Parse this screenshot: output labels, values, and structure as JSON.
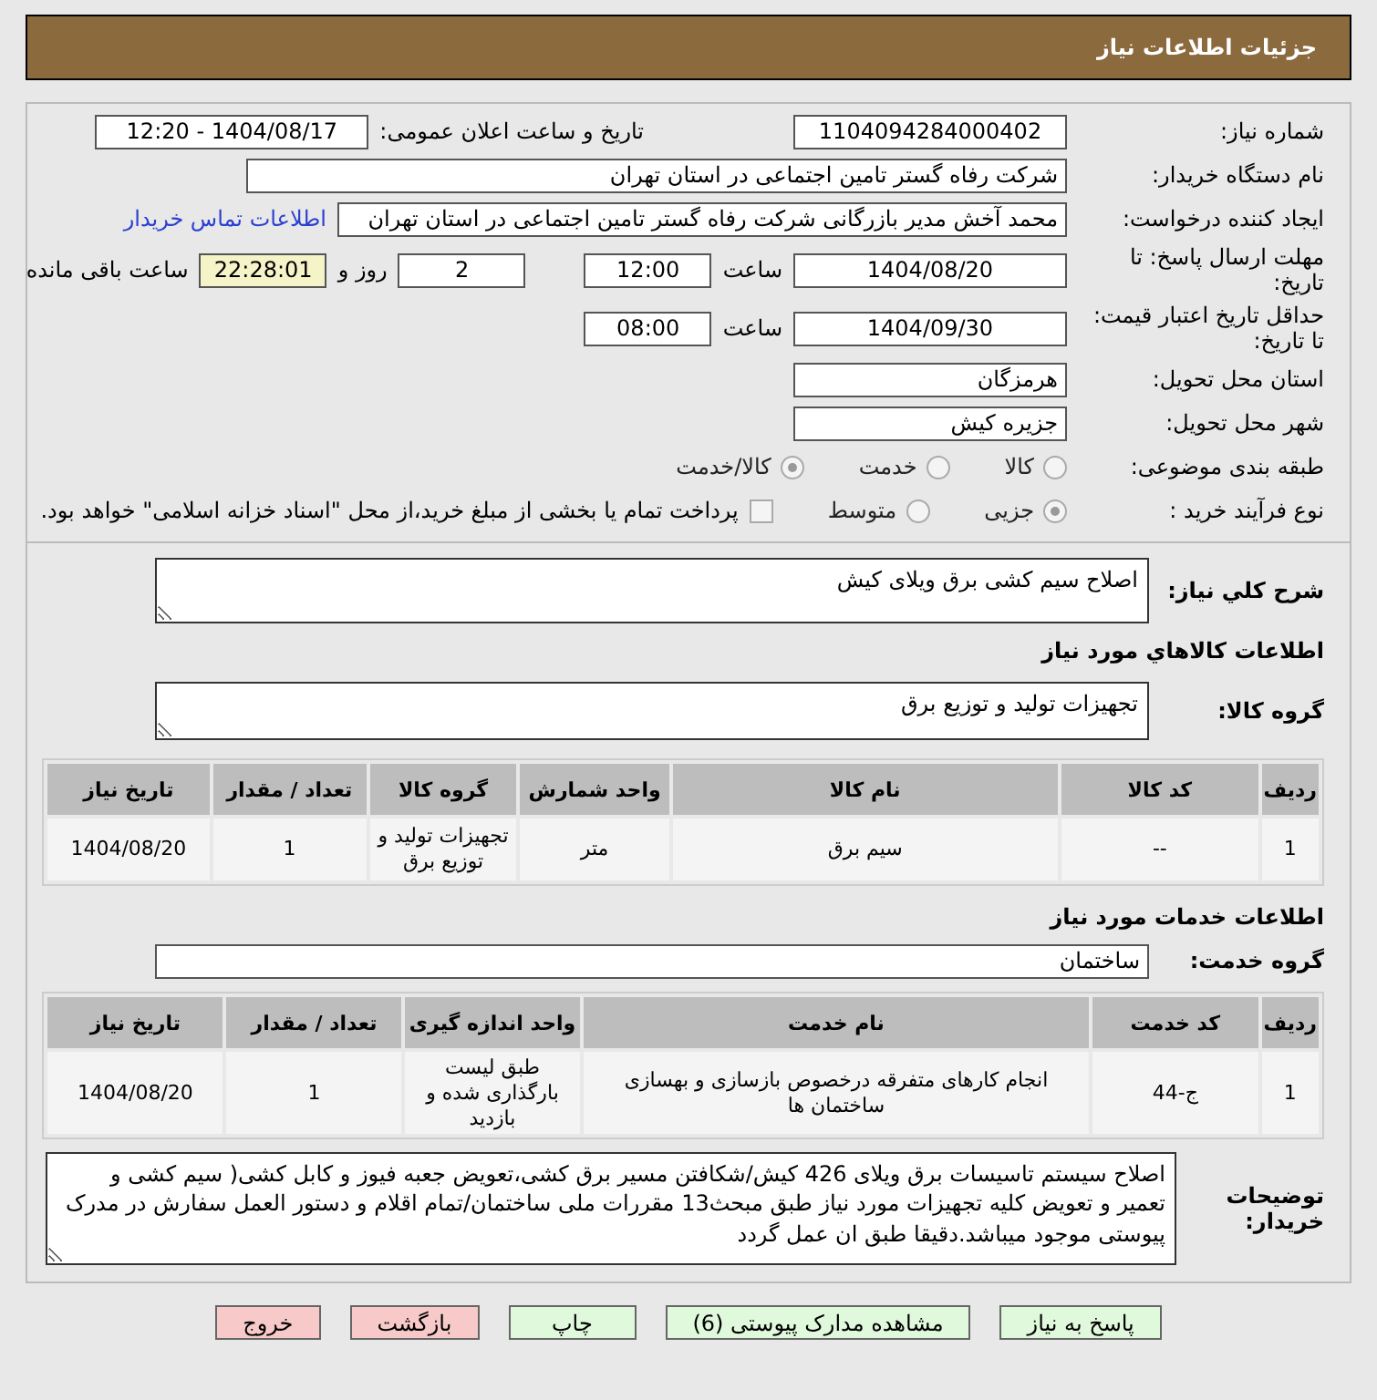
{
  "header": {
    "title": "جزئیات اطلاعات نیاز"
  },
  "need_number": {
    "label": "شماره نیاز:",
    "value": "1104094284000402"
  },
  "announce": {
    "label": "تاریخ و ساعت اعلان عمومی:",
    "value": "1404/08/17 - 12:20"
  },
  "buyer": {
    "label": "نام دستگاه خریدار:",
    "value": "شرکت رفاه گستر تامین اجتماعی در استان تهران"
  },
  "requester": {
    "label": "ایجاد کننده درخواست:",
    "value": "محمد آخش مدیر بازرگانی شرکت رفاه گستر تامین اجتماعی در استان تهران",
    "link": "اطلاعات تماس خریدار"
  },
  "deadline": {
    "label": "مهلت ارسال پاسخ: تا تاریخ:",
    "date": "1404/08/20",
    "time_label": "ساعت",
    "time": "12:00",
    "days": "2",
    "days_label": "روز و",
    "remaining": "22:28:01",
    "remaining_label": "ساعت باقی مانده"
  },
  "validity": {
    "label": "حداقل تاریخ اعتبار قیمت: تا تاریخ:",
    "date": "1404/09/30",
    "time_label": "ساعت",
    "time": "08:00"
  },
  "province": {
    "label": "استان محل تحویل:",
    "value": "هرمزگان"
  },
  "city": {
    "label": "شهر محل تحویل:",
    "value": "جزیره کیش"
  },
  "category": {
    "label": "طبقه بندی موضوعی:",
    "options": [
      {
        "label": "کالا",
        "selected": false
      },
      {
        "label": "خدمت",
        "selected": false
      },
      {
        "label": "کالا/خدمت",
        "selected": true
      }
    ]
  },
  "process": {
    "label": "نوع فرآیند خرید :",
    "options": [
      {
        "label": "جزیی",
        "selected": true
      },
      {
        "label": "متوسط",
        "selected": false
      }
    ],
    "payment": {
      "checked": false,
      "label": "پرداخت تمام یا بخشی از مبلغ خرید،از محل \"اسناد خزانه اسلامی\" خواهد بود."
    }
  },
  "summary": {
    "label": "شرح کلي نياز:",
    "value": "اصلاح سیم کشی برق ویلای کیش"
  },
  "goods": {
    "title": "اطلاعات کالاهاي مورد نياز",
    "group_label": "گروه کالا:",
    "group_value": "تجهیزات تولید و توزیع برق",
    "columns": [
      "ردیف",
      "کد کالا",
      "نام کالا",
      "واحد شمارش",
      "گروه کالا",
      "تعداد / مقدار",
      "تاریخ نیاز"
    ],
    "rows": [
      [
        "1",
        "--",
        "سیم برق",
        "متر",
        "تجهیزات تولید و توزیع برق",
        "1",
        "1404/08/20"
      ]
    ]
  },
  "services": {
    "title": "اطلاعات خدمات مورد نياز",
    "group_label": "گروه خدمت:",
    "group_value": "ساختمان",
    "columns": [
      "ردیف",
      "کد خدمت",
      "نام خدمت",
      "واحد اندازه گیری",
      "تعداد / مقدار",
      "تاریخ نیاز"
    ],
    "rows": [
      [
        "1",
        "ج-44",
        "انجام کارهای متفرقه درخصوص بازسازی و بهسازی ساختمان ها",
        "طبق لیست بارگذاری شده و بازدید",
        "1",
        "1404/08/20"
      ]
    ]
  },
  "notes": {
    "label": "توضیحات خریدار:",
    "value": "اصلاح سیستم تاسیسات برق ویلای 426 کیش/شکافتن مسیر برق کشی،تعویض جعبه فیوز و کابل کشی( سیم کشی و تعمیر و تعویض کلیه تجهیزات مورد نیاز طبق مبحث13 مقررات ملی ساختمان/تمام اقلام و دستور العمل سفارش در مدرک پیوستی موجود میباشد.دقیقا طبق ان عمل گردد"
  },
  "buttons": [
    {
      "label": "پاسخ به نیاز",
      "kind": "normal"
    },
    {
      "label": "مشاهده مدارک پیوستی (6)",
      "kind": "normal"
    },
    {
      "label": "چاپ",
      "kind": "normal"
    },
    {
      "label": "بازگشت",
      "kind": "danger"
    },
    {
      "label": "خروج",
      "kind": "danger"
    }
  ]
}
